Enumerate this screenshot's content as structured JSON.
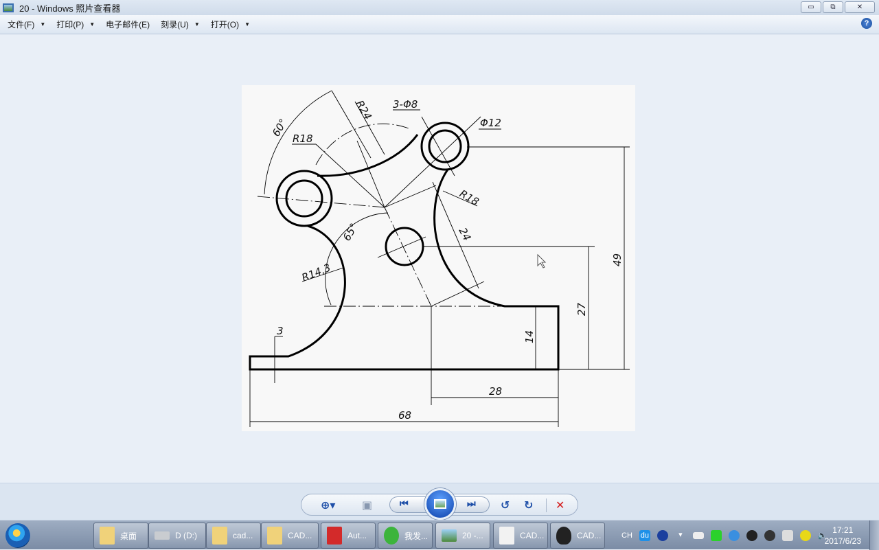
{
  "window": {
    "title": "20 - Windows 照片查看器",
    "buttons": {
      "minimize": "▭",
      "restore": "⧉",
      "close": "✕"
    }
  },
  "menu": {
    "items": [
      {
        "label": "文件(F)",
        "dropdown": true
      },
      {
        "label": "打印(P)",
        "dropdown": true
      },
      {
        "label": "电子邮件(E)",
        "dropdown": false
      },
      {
        "label": "刻录(U)",
        "dropdown": true
      },
      {
        "label": "打开(O)",
        "dropdown": true
      }
    ],
    "help": "?"
  },
  "drawing": {
    "labels": {
      "angle_60": "60°",
      "r24": "R24",
      "holes": "3-Φ8",
      "dia12": "Φ12",
      "r18_left": "R18",
      "r18_right": "R18",
      "dim_24": "24",
      "angle_65": "65°",
      "r14_3": "R14,3",
      "dim_49": "49",
      "dim_27": "27",
      "dim_14": "14",
      "dim_3": "3",
      "dim_28": "28",
      "dim_68": "68"
    }
  },
  "controls": {
    "zoom": "zoom-icon",
    "fit": "actual-size-icon",
    "prev": "previous-icon",
    "slideshow": "slideshow-icon",
    "next": "next-icon",
    "rotate_ccw": "rotate-counterclockwise-icon",
    "rotate_cw": "rotate-clockwise-icon",
    "delete": "delete-icon",
    "colors": {
      "accent": "#1e4fa8",
      "delete": "#d42020"
    }
  },
  "taskbar": {
    "items": [
      {
        "label": "桌面",
        "icon": "folder-icon"
      },
      {
        "label": "D (D:)",
        "icon": "drive-icon"
      },
      {
        "label": "cad...",
        "icon": "folder-icon"
      },
      {
        "label": "CAD...",
        "icon": "folder-icon"
      },
      {
        "label": "Aut...",
        "icon": "autocad-icon"
      },
      {
        "label": "我发...",
        "icon": "browser-icon"
      },
      {
        "label": "20 -...",
        "icon": "photo-viewer-icon"
      },
      {
        "label": "CAD...",
        "icon": "document-icon"
      },
      {
        "label": "CAD...",
        "icon": "qq-icon"
      }
    ],
    "tray": {
      "lang": "CH",
      "baidu": "du"
    },
    "clock": {
      "time": "17:21",
      "date": "2017/6/23"
    }
  }
}
